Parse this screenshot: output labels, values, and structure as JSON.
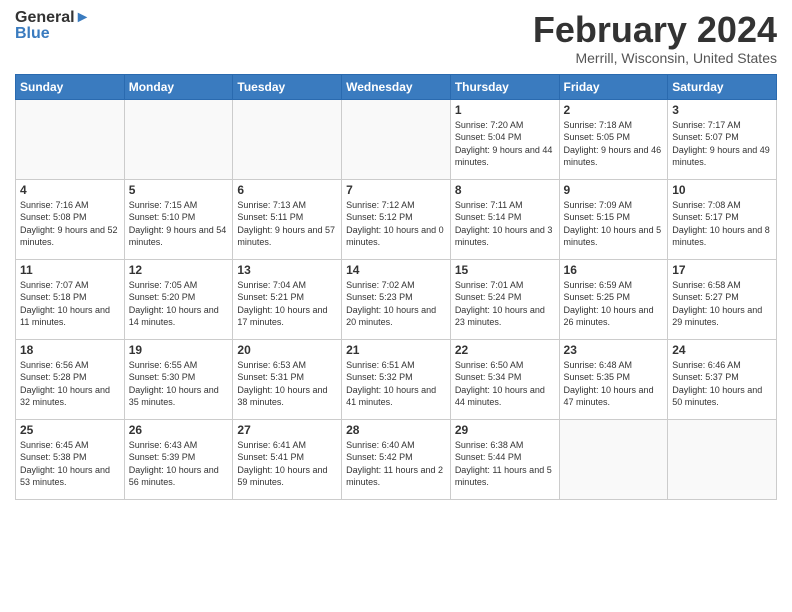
{
  "header": {
    "logo_general": "General",
    "logo_blue": "Blue",
    "month_title": "February 2024",
    "location": "Merrill, Wisconsin, United States"
  },
  "days_of_week": [
    "Sunday",
    "Monday",
    "Tuesday",
    "Wednesday",
    "Thursday",
    "Friday",
    "Saturday"
  ],
  "weeks": [
    [
      {
        "day": "",
        "sunrise": "",
        "sunset": "",
        "daylight": ""
      },
      {
        "day": "",
        "sunrise": "",
        "sunset": "",
        "daylight": ""
      },
      {
        "day": "",
        "sunrise": "",
        "sunset": "",
        "daylight": ""
      },
      {
        "day": "",
        "sunrise": "",
        "sunset": "",
        "daylight": ""
      },
      {
        "day": "1",
        "sunrise": "Sunrise: 7:20 AM",
        "sunset": "Sunset: 5:04 PM",
        "daylight": "Daylight: 9 hours and 44 minutes."
      },
      {
        "day": "2",
        "sunrise": "Sunrise: 7:18 AM",
        "sunset": "Sunset: 5:05 PM",
        "daylight": "Daylight: 9 hours and 46 minutes."
      },
      {
        "day": "3",
        "sunrise": "Sunrise: 7:17 AM",
        "sunset": "Sunset: 5:07 PM",
        "daylight": "Daylight: 9 hours and 49 minutes."
      }
    ],
    [
      {
        "day": "4",
        "sunrise": "Sunrise: 7:16 AM",
        "sunset": "Sunset: 5:08 PM",
        "daylight": "Daylight: 9 hours and 52 minutes."
      },
      {
        "day": "5",
        "sunrise": "Sunrise: 7:15 AM",
        "sunset": "Sunset: 5:10 PM",
        "daylight": "Daylight: 9 hours and 54 minutes."
      },
      {
        "day": "6",
        "sunrise": "Sunrise: 7:13 AM",
        "sunset": "Sunset: 5:11 PM",
        "daylight": "Daylight: 9 hours and 57 minutes."
      },
      {
        "day": "7",
        "sunrise": "Sunrise: 7:12 AM",
        "sunset": "Sunset: 5:12 PM",
        "daylight": "Daylight: 10 hours and 0 minutes."
      },
      {
        "day": "8",
        "sunrise": "Sunrise: 7:11 AM",
        "sunset": "Sunset: 5:14 PM",
        "daylight": "Daylight: 10 hours and 3 minutes."
      },
      {
        "day": "9",
        "sunrise": "Sunrise: 7:09 AM",
        "sunset": "Sunset: 5:15 PM",
        "daylight": "Daylight: 10 hours and 5 minutes."
      },
      {
        "day": "10",
        "sunrise": "Sunrise: 7:08 AM",
        "sunset": "Sunset: 5:17 PM",
        "daylight": "Daylight: 10 hours and 8 minutes."
      }
    ],
    [
      {
        "day": "11",
        "sunrise": "Sunrise: 7:07 AM",
        "sunset": "Sunset: 5:18 PM",
        "daylight": "Daylight: 10 hours and 11 minutes."
      },
      {
        "day": "12",
        "sunrise": "Sunrise: 7:05 AM",
        "sunset": "Sunset: 5:20 PM",
        "daylight": "Daylight: 10 hours and 14 minutes."
      },
      {
        "day": "13",
        "sunrise": "Sunrise: 7:04 AM",
        "sunset": "Sunset: 5:21 PM",
        "daylight": "Daylight: 10 hours and 17 minutes."
      },
      {
        "day": "14",
        "sunrise": "Sunrise: 7:02 AM",
        "sunset": "Sunset: 5:23 PM",
        "daylight": "Daylight: 10 hours and 20 minutes."
      },
      {
        "day": "15",
        "sunrise": "Sunrise: 7:01 AM",
        "sunset": "Sunset: 5:24 PM",
        "daylight": "Daylight: 10 hours and 23 minutes."
      },
      {
        "day": "16",
        "sunrise": "Sunrise: 6:59 AM",
        "sunset": "Sunset: 5:25 PM",
        "daylight": "Daylight: 10 hours and 26 minutes."
      },
      {
        "day": "17",
        "sunrise": "Sunrise: 6:58 AM",
        "sunset": "Sunset: 5:27 PM",
        "daylight": "Daylight: 10 hours and 29 minutes."
      }
    ],
    [
      {
        "day": "18",
        "sunrise": "Sunrise: 6:56 AM",
        "sunset": "Sunset: 5:28 PM",
        "daylight": "Daylight: 10 hours and 32 minutes."
      },
      {
        "day": "19",
        "sunrise": "Sunrise: 6:55 AM",
        "sunset": "Sunset: 5:30 PM",
        "daylight": "Daylight: 10 hours and 35 minutes."
      },
      {
        "day": "20",
        "sunrise": "Sunrise: 6:53 AM",
        "sunset": "Sunset: 5:31 PM",
        "daylight": "Daylight: 10 hours and 38 minutes."
      },
      {
        "day": "21",
        "sunrise": "Sunrise: 6:51 AM",
        "sunset": "Sunset: 5:32 PM",
        "daylight": "Daylight: 10 hours and 41 minutes."
      },
      {
        "day": "22",
        "sunrise": "Sunrise: 6:50 AM",
        "sunset": "Sunset: 5:34 PM",
        "daylight": "Daylight: 10 hours and 44 minutes."
      },
      {
        "day": "23",
        "sunrise": "Sunrise: 6:48 AM",
        "sunset": "Sunset: 5:35 PM",
        "daylight": "Daylight: 10 hours and 47 minutes."
      },
      {
        "day": "24",
        "sunrise": "Sunrise: 6:46 AM",
        "sunset": "Sunset: 5:37 PM",
        "daylight": "Daylight: 10 hours and 50 minutes."
      }
    ],
    [
      {
        "day": "25",
        "sunrise": "Sunrise: 6:45 AM",
        "sunset": "Sunset: 5:38 PM",
        "daylight": "Daylight: 10 hours and 53 minutes."
      },
      {
        "day": "26",
        "sunrise": "Sunrise: 6:43 AM",
        "sunset": "Sunset: 5:39 PM",
        "daylight": "Daylight: 10 hours and 56 minutes."
      },
      {
        "day": "27",
        "sunrise": "Sunrise: 6:41 AM",
        "sunset": "Sunset: 5:41 PM",
        "daylight": "Daylight: 10 hours and 59 minutes."
      },
      {
        "day": "28",
        "sunrise": "Sunrise: 6:40 AM",
        "sunset": "Sunset: 5:42 PM",
        "daylight": "Daylight: 11 hours and 2 minutes."
      },
      {
        "day": "29",
        "sunrise": "Sunrise: 6:38 AM",
        "sunset": "Sunset: 5:44 PM",
        "daylight": "Daylight: 11 hours and 5 minutes."
      },
      {
        "day": "",
        "sunrise": "",
        "sunset": "",
        "daylight": ""
      },
      {
        "day": "",
        "sunrise": "",
        "sunset": "",
        "daylight": ""
      }
    ]
  ]
}
